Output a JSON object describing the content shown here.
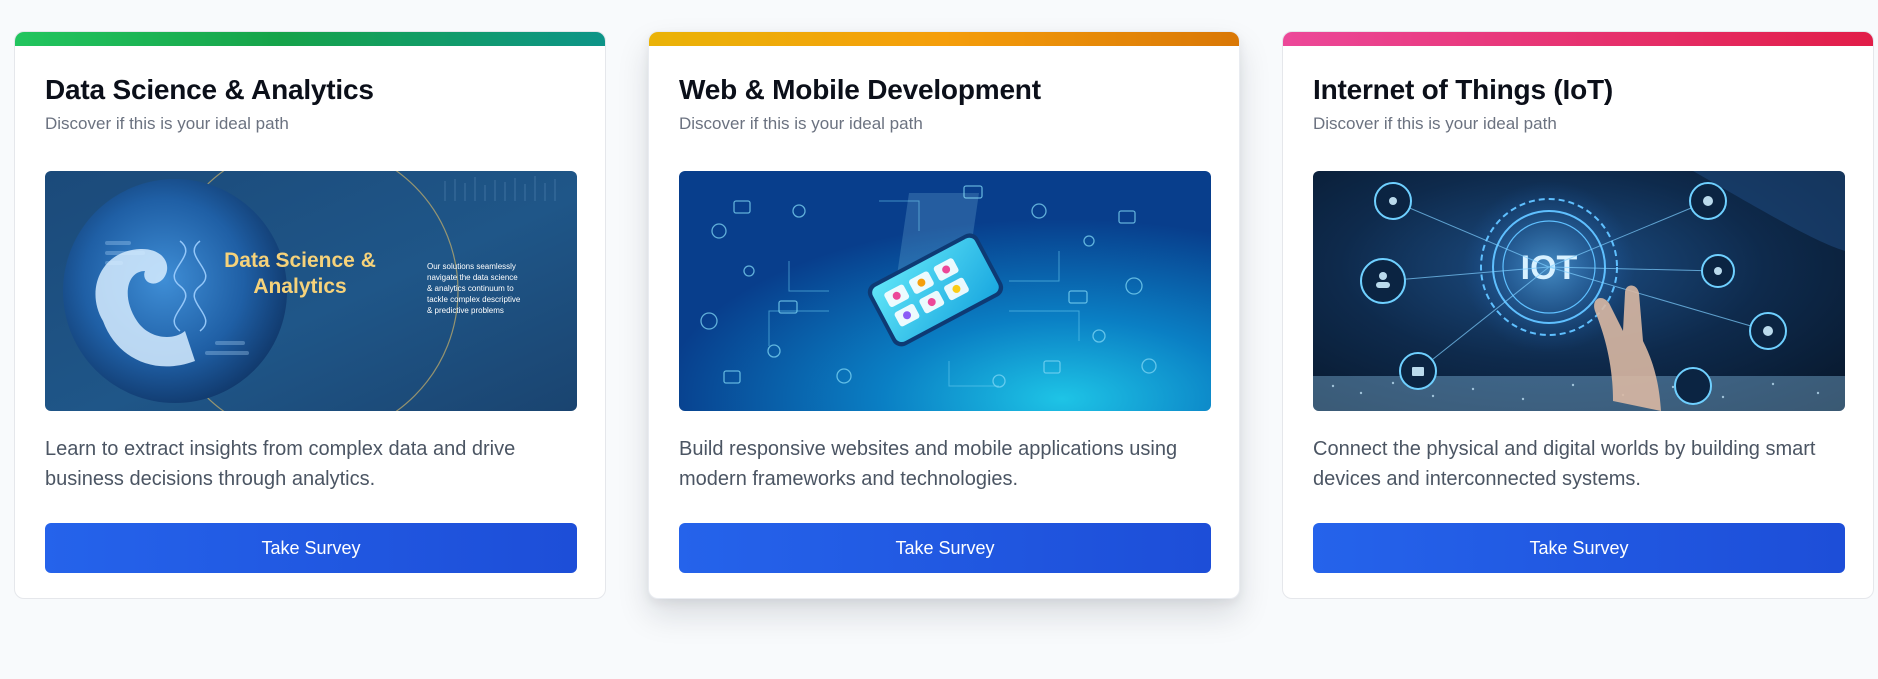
{
  "common": {
    "subtitle": "Discover if this is your ideal path",
    "button_label": "Take Survey"
  },
  "cards": [
    {
      "title": "Data Science & Analytics",
      "image": {
        "headline_line1": "Data Science &",
        "headline_line2": "Analytics",
        "caption_line1": "Our solutions seamlessly",
        "caption_line2": "navigate the data science",
        "caption_line3": "& analytics continuum to",
        "caption_line4": "tackle complex descriptive",
        "caption_line5": "& predictive problems"
      },
      "description": "Learn to extract insights from complex data and drive business decisions through analytics."
    },
    {
      "title": "Web & Mobile Development",
      "description": "Build responsive websites and mobile applications using modern frameworks and technologies."
    },
    {
      "title": "Internet of Things (IoT)",
      "image": {
        "label": "IOT"
      },
      "description": "Connect the physical and digital worlds by building smart devices and interconnected systems."
    }
  ],
  "colors": {
    "accent_data_science": "#16a34a",
    "accent_web_mobile": "#f59e0b",
    "accent_iot": "#e11d48",
    "button": "#2563eb"
  }
}
